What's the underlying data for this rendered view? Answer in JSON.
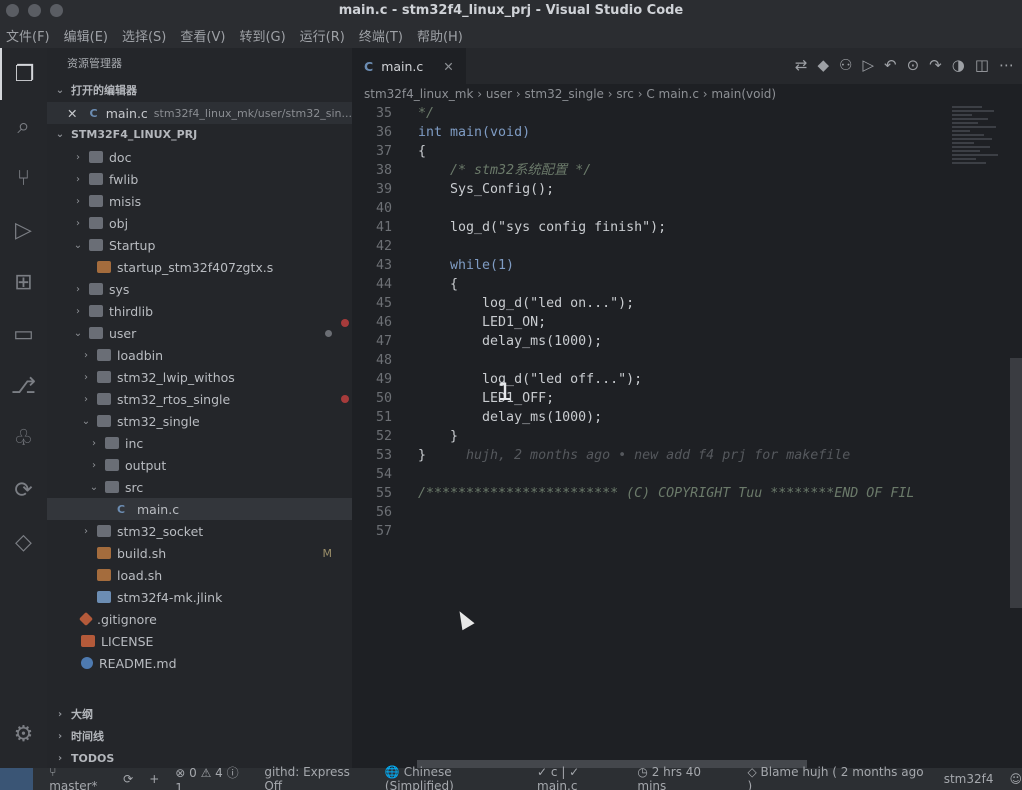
{
  "window": {
    "title": "main.c - stm32f4_linux_prj - Visual Studio Code"
  },
  "menu": [
    "文件(F)",
    "编辑(E)",
    "选择(S)",
    "查看(V)",
    "转到(G)",
    "运行(R)",
    "终端(T)",
    "帮助(H)"
  ],
  "explorer": {
    "title": "资源管理器",
    "open_editors_label": "打开的编辑器",
    "open_editor": {
      "name": "main.c",
      "path": "stm32f4_linux_mk/user/stm32_sin..."
    },
    "project_label": "STM32F4_LINUX_PRJ",
    "tree": [
      {
        "label": "doc"
      },
      {
        "label": "fwlib"
      },
      {
        "label": "misis"
      },
      {
        "label": "obj"
      },
      {
        "label": "Startup"
      },
      {
        "label": "startup_stm32f407zgtx.s"
      },
      {
        "label": "sys"
      },
      {
        "label": "thirdlib"
      },
      {
        "label": "user"
      },
      {
        "label": "loadbin"
      },
      {
        "label": "stm32_lwip_withos"
      },
      {
        "label": "stm32_rtos_single"
      },
      {
        "label": "stm32_single"
      },
      {
        "label": "inc"
      },
      {
        "label": "output"
      },
      {
        "label": "src"
      },
      {
        "label": "main.c"
      },
      {
        "label": "stm32_socket"
      },
      {
        "label": "build.sh",
        "badge": "M"
      },
      {
        "label": "load.sh"
      },
      {
        "label": "stm32f4-mk.jlink"
      },
      {
        "label": ".gitignore"
      },
      {
        "label": "LICENSE"
      },
      {
        "label": "README.md"
      }
    ],
    "outline_label": "大纲",
    "timeline_label": "时间线",
    "todos_label": "TODOS"
  },
  "editor": {
    "tab": {
      "icon": "C",
      "name": "main.c"
    },
    "breadcrumb": [
      "stm32f4_linux_mk",
      "user",
      "stm32_single",
      "src",
      "C main.c",
      "main(void)"
    ],
    "lines": [
      {
        "n": "35",
        "t": "*/"
      },
      {
        "n": "36",
        "t": "int main(void)"
      },
      {
        "n": "37",
        "t": "{"
      },
      {
        "n": "38",
        "t": "    /* stm32系统配置 */"
      },
      {
        "n": "39",
        "t": "    Sys_Config();"
      },
      {
        "n": "40",
        "t": ""
      },
      {
        "n": "41",
        "t": "    log_d(\"sys config finish\");"
      },
      {
        "n": "42",
        "t": ""
      },
      {
        "n": "43",
        "t": "    while(1)"
      },
      {
        "n": "44",
        "t": "    {"
      },
      {
        "n": "45",
        "t": "        log_d(\"led on...\");"
      },
      {
        "n": "46",
        "t": "        LED1_ON;"
      },
      {
        "n": "47",
        "t": "        delay_ms(1000);"
      },
      {
        "n": "48",
        "t": ""
      },
      {
        "n": "49",
        "t": "        log_d(\"led off...\");"
      },
      {
        "n": "50",
        "t": "        LED1_OFF;"
      },
      {
        "n": "51",
        "t": "        delay_ms(1000);"
      },
      {
        "n": "52",
        "t": "    }"
      },
      {
        "n": "53",
        "t": "}"
      },
      {
        "n": "54",
        "t": ""
      },
      {
        "n": "55",
        "t": "/************************ (C) COPYRIGHT Tuu ********END OF FIL"
      },
      {
        "n": "56",
        "t": ""
      },
      {
        "n": "57",
        "t": ""
      }
    ],
    "blame_inline": "hujh, 2 months ago • new add f4 prj for makefile",
    "overlay_number": "1"
  },
  "status": {
    "branch": "master*",
    "errors": "0",
    "warnings": "4",
    "info": "1",
    "githd": "githd: Express Off",
    "language": "Chinese (Simplified)",
    "lang_mode": "c",
    "file": "main.c",
    "time": "2 hrs 40 mins",
    "blame": "Blame hujh ( 2 months ago )",
    "project": "stm32f4"
  }
}
